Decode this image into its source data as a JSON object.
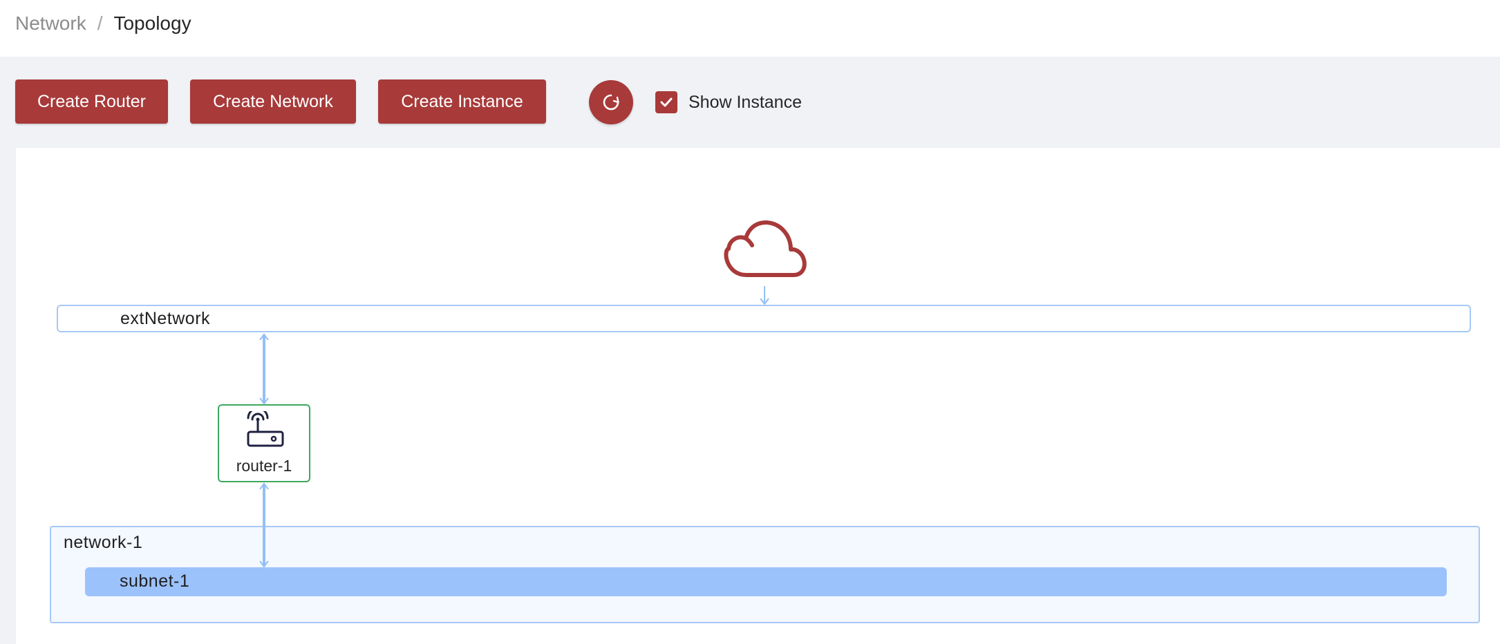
{
  "breadcrumb": {
    "parent": "Network",
    "separator": "/",
    "current": "Topology"
  },
  "toolbar": {
    "create_router": "Create Router",
    "create_network": "Create Network",
    "create_instance": "Create Instance",
    "refresh_icon": "refresh-icon",
    "show_instance_label": "Show Instance",
    "show_instance_checked": true
  },
  "topology": {
    "external_network": {
      "label": "extNetwork",
      "icon": "cloud-icon"
    },
    "router": {
      "label": "router-1",
      "icon": "router-icon",
      "status_color": "#3ea85f"
    },
    "network": {
      "label": "network-1",
      "subnets": [
        {
          "label": "subnet-1"
        }
      ]
    }
  },
  "colors": {
    "accent": "#a83a3a",
    "link": "#94bff5",
    "subnet": "#9cc2fb",
    "router_border": "#3ea85f"
  }
}
